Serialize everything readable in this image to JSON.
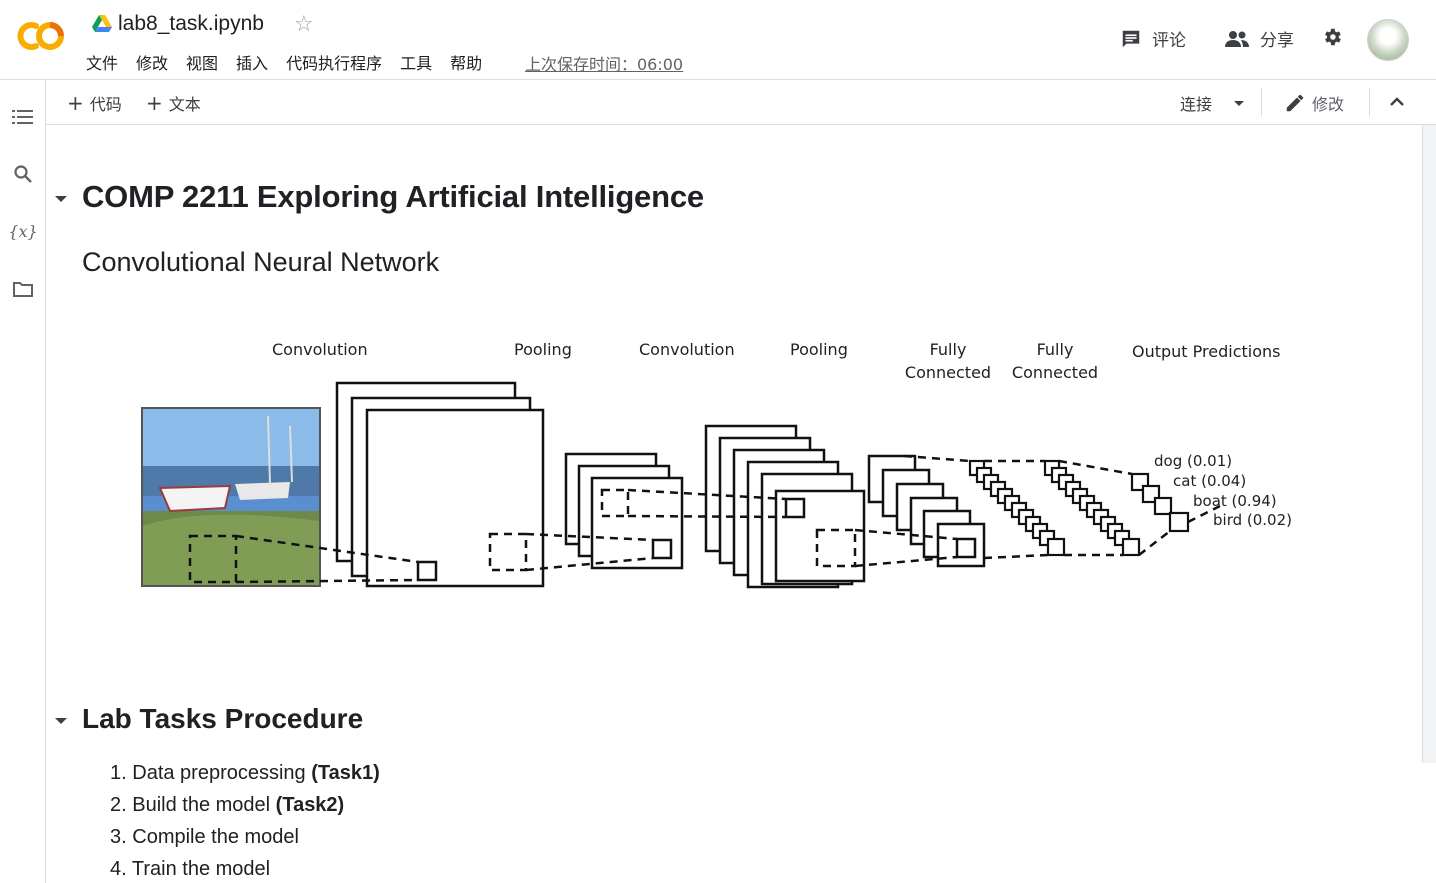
{
  "header": {
    "title": "lab8_task.ipynb",
    "menu": [
      "文件",
      "修改",
      "视图",
      "插入",
      "代码执行程序",
      "工具",
      "帮助"
    ],
    "save_status": "上次保存时间：06:00",
    "comment_label": "评论",
    "share_label": "分享"
  },
  "toolbar": {
    "add_code": "代码",
    "add_text": "文本",
    "connect": "连接",
    "edit": "修改"
  },
  "notebook": {
    "title": "COMP 2211 Exploring Artificial Intelligence",
    "subtitle": "Convolutional Neural Network",
    "section_heading": "Lab Tasks Procedure",
    "steps": [
      {
        "num": "1.",
        "text": "Data preprocessing ",
        "bold": "(Task1)"
      },
      {
        "num": "2.",
        "text": "Build the model ",
        "bold": "(Task2)"
      },
      {
        "num": "3.",
        "text": "Compile the model",
        "bold": ""
      },
      {
        "num": "4.",
        "text": "Train the model",
        "bold": ""
      }
    ]
  },
  "diagram": {
    "stage_labels": {
      "conv1": "Convolution",
      "pool1": "Pooling",
      "conv2": "Convolution",
      "pool2": "Pooling",
      "fc1_line1": "Fully",
      "fc1_line2": "Connected",
      "fc2_line1": "Fully",
      "fc2_line2": "Connected",
      "output": "Output Predictions"
    },
    "predictions": [
      {
        "label": "dog (0.01)"
      },
      {
        "label": "cat (0.04)"
      },
      {
        "label": "boat (0.94)"
      },
      {
        "label": "bird (0.02)"
      }
    ]
  },
  "colors": {
    "logo_orange": "#f9ab00",
    "logo_dark_orange": "#e8710a",
    "text": "#202124",
    "muted": "#5f6368",
    "border": "#dadce0"
  },
  "icons": {
    "toc": "table-of-contents-icon",
    "search": "search-icon",
    "variables": "variables-icon",
    "files": "folder-icon",
    "comment": "comment-icon",
    "share": "people-icon",
    "settings": "gear-icon"
  }
}
